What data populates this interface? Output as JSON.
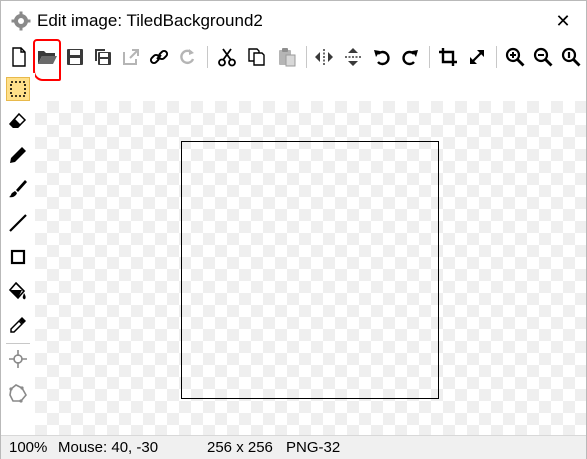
{
  "window": {
    "title": "Edit image: TiledBackground2",
    "app_icon": "gear-icon",
    "close_symbol": "✕"
  },
  "toolbar": {
    "items": [
      "new-image-icon",
      "open-folder-icon",
      "save-icon",
      "save-as-icon",
      "export-icon",
      "link-icon",
      "refresh-icon",
      "cut-icon",
      "copy-icon",
      "paste-icon",
      "flip-horizontal-icon",
      "flip-vertical-icon",
      "rotate-left-icon",
      "rotate-right-icon",
      "crop-icon",
      "resize-icon",
      "zoom-in-icon",
      "zoom-out-icon",
      "zoom-actual-icon"
    ]
  },
  "tools": {
    "items": [
      "selection-tool",
      "eraser-tool",
      "pencil-tool",
      "brush-tool",
      "line-tool",
      "rectangle-tool",
      "fill-tool",
      "color-picker-tool",
      "origin-tool",
      "shape-tool"
    ],
    "active": "selection-tool"
  },
  "status": {
    "zoom": "100%",
    "mouse": "Mouse: 40, -30",
    "size": "256 x 256",
    "format": "PNG-32"
  },
  "colors": {
    "highlight": "#ff0000",
    "active_tool": "#ffe08a",
    "checker": "#efefef"
  }
}
